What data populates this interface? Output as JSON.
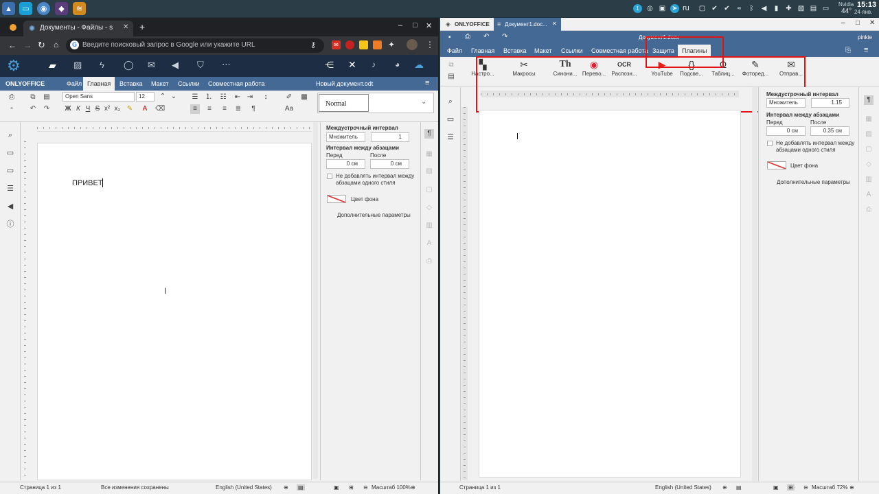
{
  "taskbar": {
    "tray": {
      "lang": "ru",
      "gpu_label": "Nvidia",
      "gpu_temp": "44°",
      "time": "15:13",
      "date": "24 янв."
    }
  },
  "left": {
    "chrome": {
      "tab_title": "Документы - Файлы - s",
      "new_tab": "+",
      "omnibox_placeholder": "Введите поисковый запрос в Google или укажите URL"
    },
    "oo": {
      "logo": "ONLYOFFICE",
      "menu": [
        "Файл",
        "Главная",
        "Вставка",
        "Макет",
        "Ссылки",
        "Совместная работа"
      ],
      "active_menu": "Главная",
      "doc_title": "Новый документ.odt",
      "font_name": "Open Sans",
      "font_size": "12",
      "style_preview": "Normal",
      "page_text": "ПРИВЕТ",
      "panel": {
        "line_spacing_title": "Междустрочный интервал",
        "line_spacing_mode": "Множитель",
        "line_spacing_value": "1",
        "para_spacing_title": "Интервал между абзацами",
        "before_label": "Перед",
        "after_label": "После",
        "before_value": "0 см",
        "after_value": "0 см",
        "no_interval_text_1": "Не добавлять интервал между",
        "no_interval_text_2": "абзацами одного стиля",
        "bg_color": "Цвет фона",
        "advanced": "Дополнительные параметры"
      },
      "status": {
        "page": "Страница 1 из 1",
        "saved": "Все изменения сохранены",
        "lang": "English (United States)",
        "zoom": "Масштаб 100%"
      }
    }
  },
  "right": {
    "header": {
      "logo": "ONLYOFFICE",
      "tab_title": "Документ1.doc...",
      "doc_title": "Документ1.docx",
      "user": "pinkie"
    },
    "menu": [
      "Файл",
      "Главная",
      "Вставка",
      "Макет",
      "Ссылки",
      "Совместная работа",
      "Защита",
      "Плагины"
    ],
    "active_menu": "Плагины",
    "plugins": [
      {
        "label": "Настро...",
        "icon": "settings-icon"
      },
      {
        "label": "Макросы",
        "icon": "macros-icon"
      },
      {
        "label": "Синони...",
        "icon": "thesaurus-icon"
      },
      {
        "label": "Перево...",
        "icon": "translator-icon"
      },
      {
        "label": "Распозн...",
        "icon": "ocr-icon"
      },
      {
        "label": "YouTube",
        "icon": "youtube-icon"
      },
      {
        "label": "Подсве...",
        "icon": "highlight-code-icon"
      },
      {
        "label": "Таблиц...",
        "icon": "symbol-table-icon"
      },
      {
        "label": "Фоторед...",
        "icon": "photo-editor-icon"
      },
      {
        "label": "Отправ...",
        "icon": "send-icon"
      }
    ],
    "plugin_glyphs": {
      "thesaurus": "Th",
      "ocr": "OCR",
      "code": "{}",
      "omega": "Ω"
    },
    "panel": {
      "line_spacing_title": "Междустрочный интервал",
      "line_spacing_mode": "Множитель",
      "line_spacing_value": "1.15",
      "para_spacing_title": "Интервал между абзацами",
      "before_label": "Перед",
      "after_label": "После",
      "before_value": "0 см",
      "after_value": "0.35 см",
      "no_interval_text_1": "Не добавлять интервал между",
      "no_interval_text_2": "абзацами одного стиля",
      "bg_color": "Цвет фона",
      "advanced": "Дополнительные параметры"
    },
    "status": {
      "page": "Страница 1 из 1",
      "lang": "English (United States)",
      "zoom": "Масштаб 72%"
    }
  },
  "colors": {
    "oo_blue": "#446995",
    "highlight_red": "#e41313",
    "taskbar": "#2b3e47",
    "chrome_dark": "#202124"
  }
}
